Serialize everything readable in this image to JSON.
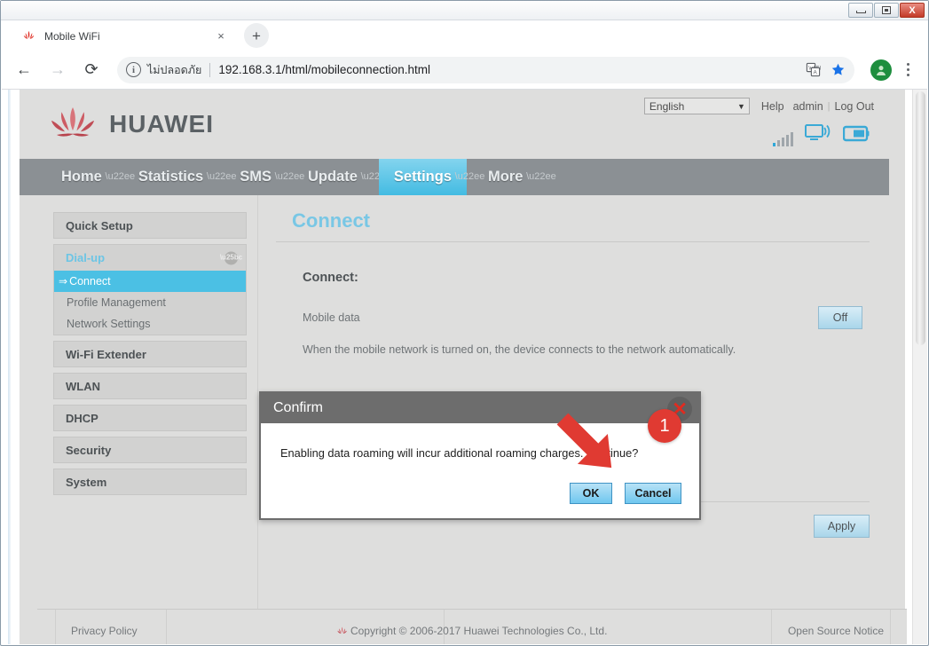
{
  "window": {
    "minimize_label": "Minimize",
    "maximize_label": "Restore",
    "close_label": "X"
  },
  "browser": {
    "tab": {
      "title": "Mobile WiFi",
      "favicon": "huawei-flower-icon",
      "close_label": "×"
    },
    "new_tab_label": "+",
    "nav": {
      "back_label": "←",
      "forward_label": "→",
      "reload_label": "⟳"
    },
    "omnibox": {
      "info_label": "i",
      "security_text": "ไม่ปลอดภัย",
      "url_host": "192.168.3.1",
      "url_path": "/html/mobileconnection.html",
      "translate_icon": "translate-icon",
      "bookmark_icon": "star-icon"
    },
    "profile_icon": "account-avatar-icon",
    "menu_icon": "kebab-menu-icon"
  },
  "page": {
    "brand": "HUAWEI",
    "language": {
      "selected": "English",
      "caret": "▼"
    },
    "top_links": [
      "Help",
      "admin",
      "Log Out"
    ],
    "status_icons": {
      "signal": "signal-bars-icon",
      "wifi": "wifi-monitor-icon",
      "battery": "battery-icon"
    },
    "nav_tabs": [
      {
        "label": "Home",
        "active": false
      },
      {
        "label": "Statistics",
        "active": false
      },
      {
        "label": "SMS",
        "active": false
      },
      {
        "label": "Update",
        "active": false
      },
      {
        "label": "Settings",
        "active": true
      },
      {
        "label": "More",
        "active": false
      }
    ],
    "sidebar": [
      {
        "label": "Quick Setup",
        "type": "head",
        "open": false
      },
      {
        "label": "Dial-up",
        "type": "group",
        "open": true,
        "children": [
          {
            "label": "Connect",
            "active": true,
            "arrow": "⇒"
          },
          {
            "label": "Profile Management",
            "active": false
          },
          {
            "label": "Network Settings",
            "active": false
          }
        ]
      },
      {
        "label": "Wi-Fi Extender",
        "type": "head",
        "open": false
      },
      {
        "label": "WLAN",
        "type": "head",
        "open": false
      },
      {
        "label": "DHCP",
        "type": "head",
        "open": false
      },
      {
        "label": "Security",
        "type": "head",
        "open": false
      },
      {
        "label": "System",
        "type": "head",
        "open": false
      }
    ],
    "main": {
      "title": "Connect",
      "section_label": "Connect:",
      "mobile_data_label": "Mobile data",
      "mobile_data_state": "Off",
      "hint": "When the mobile network is turned on, the device connects to the network automatically.",
      "apply_label": "Apply"
    },
    "footer": {
      "privacy": "Privacy Policy",
      "copyright": "Copyright © 2006-2017 Huawei Technologies Co., Ltd.",
      "open_source": "Open Source Notice"
    }
  },
  "dialog": {
    "title": "Confirm",
    "close_label": "✕",
    "message": "Enabling data roaming will incur additional roaming charges. Continue?",
    "ok_label": "OK",
    "cancel_label": "Cancel"
  },
  "annotation": {
    "step_number": "1"
  },
  "colors": {
    "accent_blue": "#4bc0e4",
    "nav_bar": "#8b9094",
    "page_bg": "#dededd",
    "dialog_header": "#6d6d6d",
    "annotation_red": "#e03a32",
    "brand_red": "#c8102e"
  }
}
